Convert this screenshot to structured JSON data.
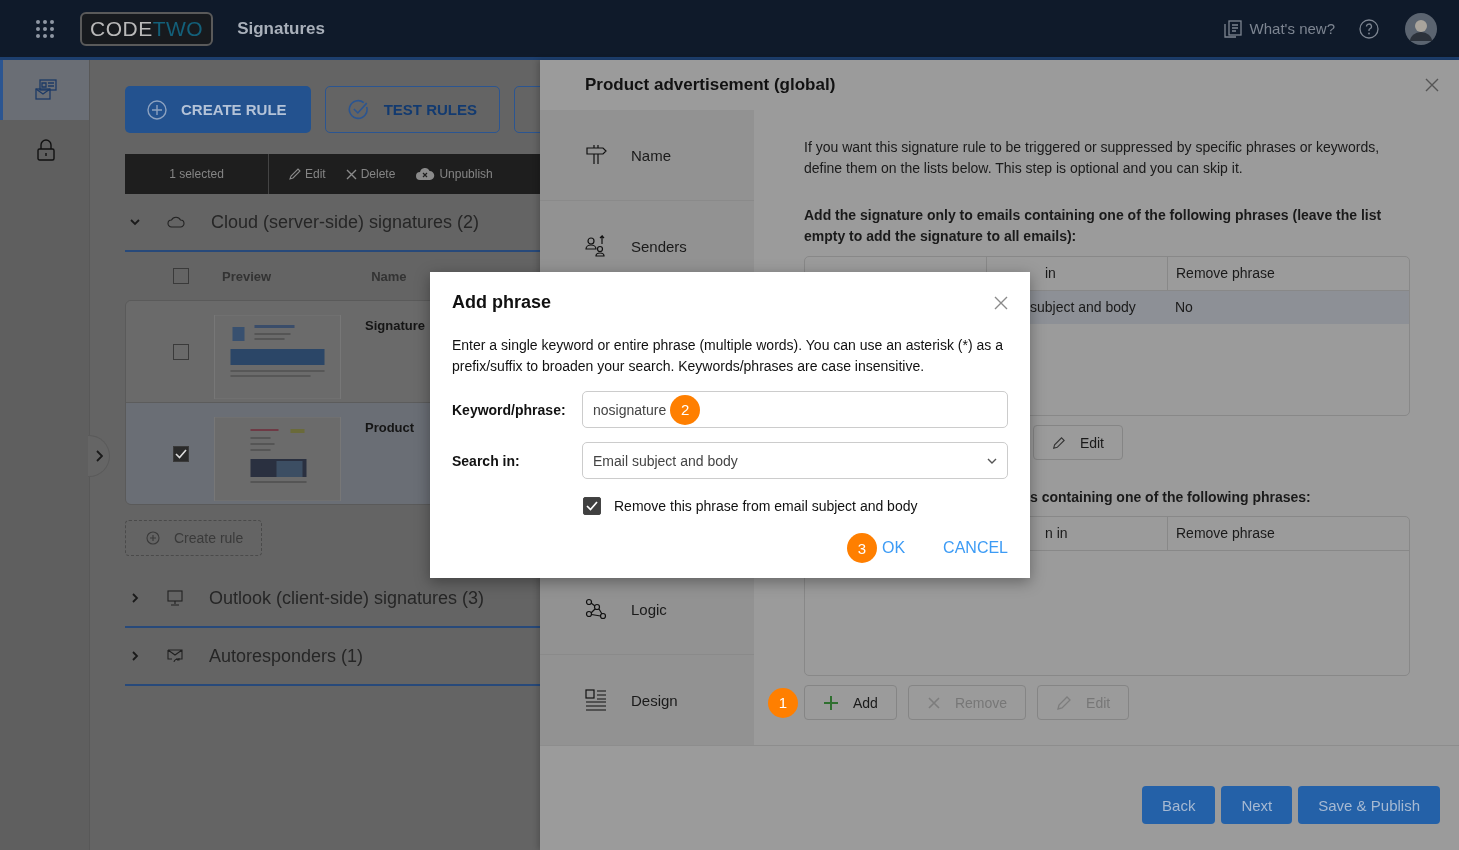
{
  "topbar": {
    "logo": {
      "part_1": "CODE",
      "part_2": "TWO"
    },
    "app_title": "Signatures",
    "whats_new": "What's new?"
  },
  "rail": [
    {
      "kind": "signatures",
      "selected": true
    },
    {
      "kind": "lock",
      "selected": false
    }
  ],
  "actions": [
    {
      "kind": "primary",
      "label": "CREATE RULE"
    },
    {
      "kind": "outline",
      "label": "TEST RULES"
    },
    {
      "kind": "cut"
    }
  ],
  "selection_bar": {
    "count": "1 selected",
    "items": [
      {
        "kind": "edit",
        "label": "Edit"
      },
      {
        "kind": "delete",
        "label": "Delete"
      },
      {
        "kind": "unpublish",
        "label": "Unpublish"
      }
    ]
  },
  "groups": [
    {
      "kind": "cloud",
      "title": "Cloud (server-side) signatures (2)",
      "expanded": true,
      "all_checked": false,
      "columns": [
        "Preview",
        "Name"
      ],
      "rules": [
        {
          "name": "Signature",
          "selected": false
        },
        {
          "name": "Product",
          "selected": true
        }
      ],
      "create_rule": "Create rule"
    },
    {
      "kind": "desktop",
      "title": "Outlook (client-side) signatures (3)",
      "expanded": false
    },
    {
      "kind": "envelope",
      "title": "Autoresponders (1)",
      "expanded": false
    }
  ],
  "panel": {
    "title": "Product advertisement (global)",
    "nav": [
      {
        "kind": "signpost",
        "label": "Name"
      },
      {
        "kind": "people",
        "label": "Senders"
      },
      {
        "kind": "logic",
        "label": "Logic"
      },
      {
        "kind": "design",
        "label": "Design"
      }
    ],
    "intro": "If you want this signature rule to be triggered or suppressed by specific phrases or keywords, define them on the lists below. This step is optional and you can skip it.",
    "section_1": {
      "heading": "Add the signature only to emails containing one of the following phrases (leave the list empty to add the signature to all emails):",
      "columns": [
        "in",
        "Remove phrase"
      ],
      "rows": [
        {
          "search_in": "subject and body",
          "remove_phrase": "No",
          "selected": true
        }
      ],
      "buttons": [
        {
          "kind": "edit",
          "label": "Edit",
          "disabled": false
        }
      ]
    },
    "section_2": {
      "heading": "s containing one of the following phrases:",
      "columns": [
        "n in",
        "Remove phrase"
      ],
      "step": "1",
      "buttons": [
        {
          "kind": "add",
          "label": "Add",
          "disabled": false
        },
        {
          "kind": "remove",
          "label": "Remove",
          "disabled": true
        },
        {
          "kind": "edit",
          "label": "Edit",
          "disabled": true
        }
      ]
    },
    "footer": [
      "Back",
      "Next",
      "Save & Publish"
    ]
  },
  "dialog": {
    "title": "Add phrase",
    "description": "Enter a single keyword or entire phrase (multiple words). You can use an asterisk (*) as a prefix/suffix to broaden your search. Keywords/phrases are case insensitive.",
    "keyword": {
      "label": "Keyword/phrase:",
      "value": "nosignature",
      "step": "2"
    },
    "search_in": {
      "label": "Search in:",
      "value": "Email subject and body"
    },
    "remove": {
      "label": "Remove this phrase from email subject and body",
      "checked": true
    },
    "ok": {
      "label": "OK",
      "step": "3"
    },
    "cancel": "CANCEL"
  }
}
